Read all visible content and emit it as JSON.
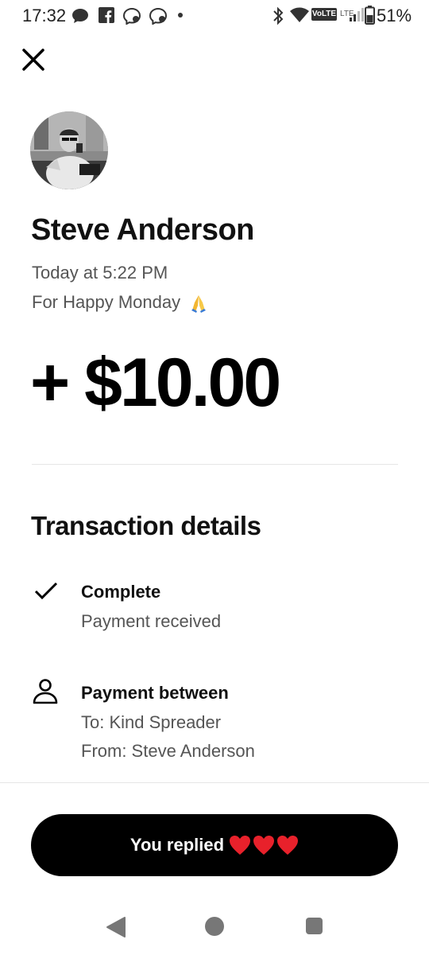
{
  "status_bar": {
    "time": "17:32",
    "network_label": "VoLTE",
    "lte_label": "LTE",
    "battery_percent": "51%"
  },
  "transaction": {
    "sender_name": "Steve Anderson",
    "timestamp": "Today at 5:22 PM",
    "note": "For Happy Monday",
    "note_emoji": "folded-hands-icon",
    "amount": "+ $10.00"
  },
  "details": {
    "section_title": "Transaction details",
    "status": {
      "title": "Complete",
      "subtitle": "Payment received",
      "icon": "checkmark-icon"
    },
    "parties": {
      "title": "Payment between",
      "to_line": "To: Kind Spreader",
      "from_line": "From: Steve Anderson",
      "icon": "person-icon"
    }
  },
  "reply_button": {
    "label": "You replied",
    "hearts": [
      "red-heart-icon",
      "red-heart-icon",
      "red-heart-icon"
    ],
    "heart_color": "#e8212b"
  },
  "nav": {
    "back": "back-triangle-icon",
    "home": "home-circle-icon",
    "recents": "recents-square-icon"
  }
}
